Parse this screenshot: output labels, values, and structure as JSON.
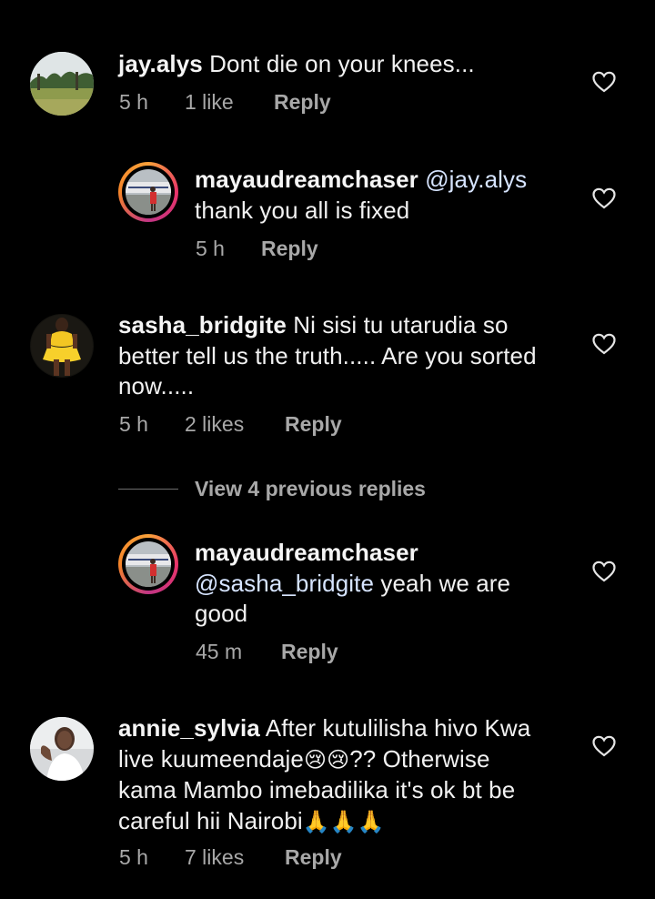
{
  "colors": {
    "background": "#000000",
    "text": "#f1f1f1",
    "meta": "#a8a8a8",
    "story_ring": "#e8336a"
  },
  "comments": [
    {
      "username": "jay.alys",
      "text": "Dont die on your knees...",
      "time": "5 h",
      "likes": "1 like",
      "reply_label": "Reply",
      "avatar_icon": "landscape-avatar",
      "heart_icon": "heart-outline-icon"
    },
    {
      "username": "mayaudreamchaser",
      "mention": "@jay.alys",
      "text": "thank you all is fixed",
      "time": "5 h",
      "reply_label": "Reply",
      "avatar_icon": "story-ring-avatar",
      "heart_icon": "heart-outline-icon"
    },
    {
      "username": "sasha_bridgite",
      "text_line1": "Ni sisi tu utarudia so",
      "text_line2": "better tell us the truth..... Are you sorted",
      "text_line3": "now.....",
      "time": "5 h",
      "likes": "2 likes",
      "reply_label": "Reply",
      "avatar_icon": "yellow-dress-avatar",
      "heart_icon": "heart-outline-icon"
    },
    {
      "username": "mayaudreamchaser",
      "mention": "@sasha_bridgite",
      "text": "yeah we are",
      "text_line3": "good",
      "time": "45 m",
      "reply_label": "Reply",
      "avatar_icon": "story-ring-avatar",
      "heart_icon": "heart-outline-icon"
    },
    {
      "username": "annie_sylvia",
      "text_line1": "After kutulilisha hivo  Kwa",
      "text_line2a": "live kuumeendaje",
      "emoji_crying": "😢😢",
      "text_line2b": "?? Otherwise",
      "text_line3": "kama Mambo imebadilika it's ok bt be",
      "text_line4": "careful hii Nairobi",
      "emoji_pray": "🙏🙏🙏",
      "time": "5 h",
      "likes": "7 likes",
      "reply_label": "Reply",
      "avatar_icon": "selfie-avatar",
      "heart_icon": "heart-outline-icon"
    }
  ],
  "view_previous": "View 4 previous replies"
}
